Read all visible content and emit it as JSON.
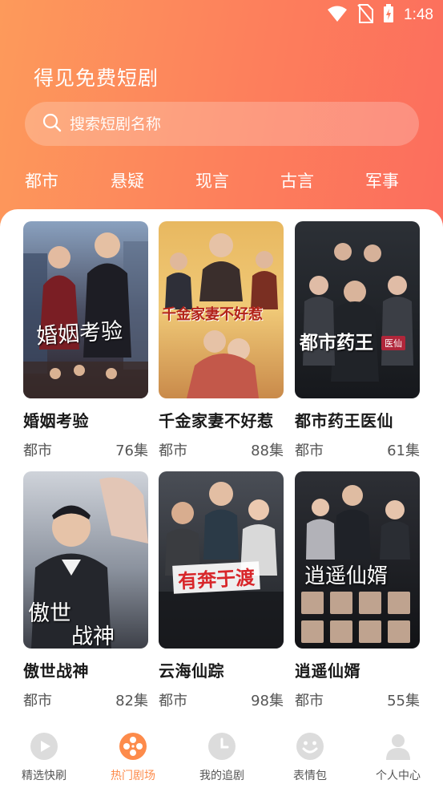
{
  "status_bar": {
    "time": "1:48"
  },
  "header": {
    "title": "得见免费短剧"
  },
  "search": {
    "placeholder": "搜索短剧名称"
  },
  "categories": [
    "都市",
    "悬疑",
    "现言",
    "古言",
    "军事"
  ],
  "dramas": [
    {
      "title": "婚姻考验",
      "poster_text": "婚姻考验",
      "genre": "都市",
      "episodes": "76集"
    },
    {
      "title": "千金家妻不好惹",
      "poster_text": "千金家妻不好惹",
      "genre": "都市",
      "episodes": "88集"
    },
    {
      "title": "都市药王医仙",
      "poster_text": "都市药王",
      "poster_text2": "医仙",
      "genre": "都市",
      "episodes": "61集"
    },
    {
      "title": "傲世战神",
      "poster_text": "傲世",
      "poster_text2": "战神",
      "genre": "都市",
      "episodes": "82集"
    },
    {
      "title": "云海仙踪",
      "poster_text": "有奔于渡",
      "genre": "都市",
      "episodes": "98集"
    },
    {
      "title": "逍遥仙婿",
      "poster_text": "逍遥仙婿",
      "genre": "都市",
      "episodes": "55集"
    }
  ],
  "tabbar": {
    "items": [
      {
        "label": "精选快刷",
        "icon": "play-icon"
      },
      {
        "label": "热门剧场",
        "icon": "film-reel-icon",
        "active": true
      },
      {
        "label": "我的追剧",
        "icon": "clock-icon"
      },
      {
        "label": "表情包",
        "icon": "smiley-icon"
      },
      {
        "label": "个人中心",
        "icon": "person-icon"
      }
    ]
  },
  "colors": {
    "header_gradient_start": "#fd9a5b",
    "header_gradient_end": "#fc6d5d",
    "active_tab": "#fd8b4b",
    "inactive_icon": "#dcdcdc"
  }
}
